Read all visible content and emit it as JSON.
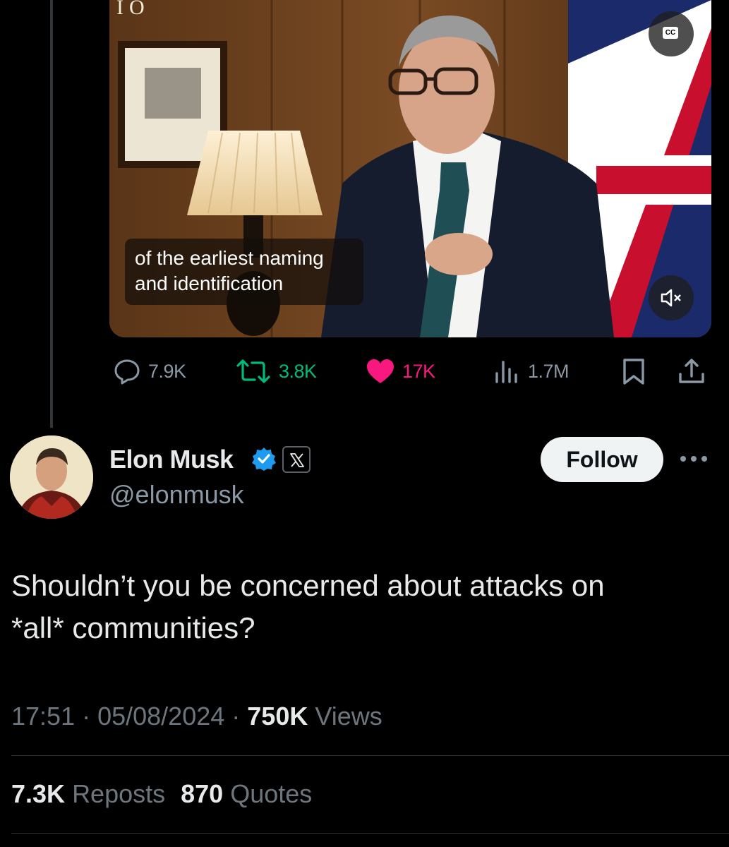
{
  "video": {
    "corner_text": "IO",
    "caption_line1": "of the earliest naming",
    "caption_line2": "and identification",
    "cc_label": "CC"
  },
  "actions": {
    "replies": "7.9K",
    "reposts": "3.8K",
    "likes": "17K",
    "views": "1.7M"
  },
  "author": {
    "name": "Elon Musk",
    "handle": "@elonmusk",
    "follow_label": "Follow"
  },
  "tweet": {
    "text_line1": "Shouldn’t you be concerned about attacks on",
    "text_line2": "*all* communities?"
  },
  "meta": {
    "time": "17:51",
    "date": "05/08/2024",
    "views_count": "750K",
    "views_label": "Views"
  },
  "stats": {
    "reposts_count": "7.3K",
    "reposts_label": "Reposts",
    "quotes_count": "870",
    "quotes_label": "Quotes"
  },
  "colors": {
    "background": "#000000",
    "reply_gray": "#8b98a5",
    "repost_green": "#00ba7c",
    "like_pink": "#f91880",
    "verified_blue": "#1d9bf0"
  }
}
